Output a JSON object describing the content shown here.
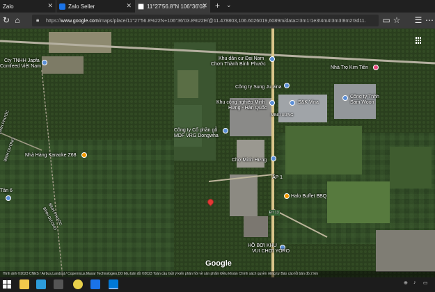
{
  "tabs": [
    {
      "title": "Zalo"
    },
    {
      "title": "Zalo Seller"
    },
    {
      "title": "11°27'56.8\"N 106°36'03"
    }
  ],
  "url": {
    "prefix": "https://",
    "host": "www.google.com",
    "path": "/maps/place/11°27'56.8%22N+106°36'03.8%22E/@11.478803,106.6026019,6089m/data=!3m1!1e3!4m4!3m3!8m2!3d11.465777"
  },
  "map": {
    "labels": [
      {
        "text": "Cty TNHH Japfa",
        "id": "japfa-1"
      },
      {
        "text": "Comfeed Việt Nam",
        "id": "japfa-2"
      },
      {
        "text": "Khu dân cư Đại Nam",
        "id": "dainam-1"
      },
      {
        "text": "Chơn Thành Bình Phước",
        "id": "dainam-2"
      },
      {
        "text": "Nhà Trọ Kim Tiền",
        "id": "kimtien"
      },
      {
        "text": "Công ty Sung Ju vina",
        "id": "sungju"
      },
      {
        "text": "S&K Vina",
        "id": "skvina"
      },
      {
        "text": "Công ty Tnhh",
        "id": "samwoon-1"
      },
      {
        "text": "Sam Woon",
        "id": "samwoon-2"
      },
      {
        "text": "Khu công nghiệp Minh",
        "id": "kcn-1"
      },
      {
        "text": "Hưng - Hàn Quốc",
        "id": "kcn-2"
      },
      {
        "text": "MINH HƯNG",
        "id": "minhhung"
      },
      {
        "text": "Công ty Cổ phần gỗ",
        "id": "mdf-1"
      },
      {
        "text": "MDF VRG Dongwha",
        "id": "mdf-2"
      },
      {
        "text": "Nhà Hàng Karaoke Z68",
        "id": "karaoke"
      },
      {
        "text": "Chợ Minh Hưng",
        "id": "cho"
      },
      {
        "text": "ẤP 1",
        "id": "ap1"
      },
      {
        "text": "Halo Buffet BBQ",
        "id": "halo"
      },
      {
        "text": "BÌNH PHƯỚC",
        "id": "binhphuoc-1"
      },
      {
        "text": "BÌNH DƯƠNG",
        "id": "binhduong-1"
      },
      {
        "text": "BÌNH PHƯỚC",
        "id": "binhphuoc-2"
      },
      {
        "text": "BÌNH DƯƠNG",
        "id": "binhduong-2"
      },
      {
        "text": "Tân 6",
        "id": "tan6"
      },
      {
        "text": "HỒ BƠI KHU",
        "id": "hoboi-1"
      },
      {
        "text": "VUI CHƠI YORO",
        "id": "hoboi-2"
      },
      {
        "text": "ĐT 13",
        "id": "dt13"
      }
    ],
    "logo": "Google",
    "credits": "Hình ảnh ©2023 CNES / Airbus,Landsat / Copernicus,Maxar Technologies,Dữ liệu bản đồ ©2023   Toàn cầu   Gửi ý kiến phản hồi về sản phẩm   Điều khoản   Chính sách quyền riêng tư   Báo cáo lỗi bản đồ   2 km"
  },
  "colors": {
    "accent_pin": "#e53935",
    "poi_blue": "#5b8fd6",
    "poi_orange": "#f29900",
    "poi_pink": "#e8467c"
  }
}
